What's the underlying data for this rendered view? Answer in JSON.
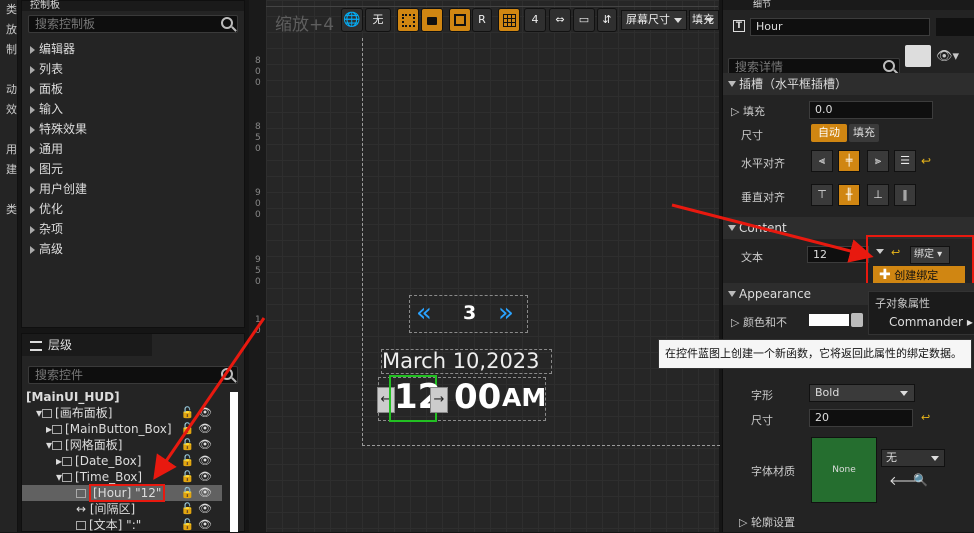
{
  "left_strip": {
    "items": [
      "类",
      "放",
      "制",
      "",
      "动",
      "效",
      "",
      "用",
      "建",
      "",
      "类"
    ]
  },
  "palette": {
    "tab": "控制板",
    "search_placeholder": "搜索控制板",
    "categories": [
      "编辑器",
      "列表",
      "面板",
      "输入",
      "特殊效果",
      "通用",
      "图元",
      "用户创建",
      "优化",
      "杂项",
      "高级"
    ]
  },
  "hierarchy": {
    "tab": "层级",
    "search_placeholder": "搜索控件",
    "rows": [
      {
        "label": "[MainUI_HUD]",
        "bold": true
      },
      {
        "label": "[画布面板]"
      },
      {
        "label": "[MainButton_Box]"
      },
      {
        "label": "[网格面板]"
      },
      {
        "label": "[Date_Box]"
      },
      {
        "label": "[Time_Box]"
      },
      {
        "label": "[Hour] \"12\""
      },
      {
        "label": "[间隔区]"
      },
      {
        "label": "[文本] \":\""
      }
    ]
  },
  "canvas": {
    "zoom_label": "缩放+4",
    "toolbar": {
      "none_label": "无",
      "r_label": "R",
      "snap_value": "4",
      "screen_size": "屏幕尺寸",
      "fill_label": "填充"
    },
    "ruler_numbers": [
      "8",
      "0",
      "0",
      "8",
      "5",
      "0",
      "9",
      "0",
      "0",
      "9",
      "5",
      "0",
      "1",
      "0"
    ],
    "widget": {
      "left_arrow": "«",
      "day_number": "3",
      "right_arrow": "»",
      "date_text": "March 10,2023",
      "hour": "12",
      "minutes": "00",
      "ampm": "AM",
      "left_btn": "←",
      "right_btn": "→"
    }
  },
  "details": {
    "tab": "细节",
    "name_value": "Hour",
    "search_placeholder": "搜索详情",
    "slot_section": "插槽（水平框插槽）",
    "fill_label": "填充",
    "fill_value": "0.0",
    "size_label": "尺寸",
    "size_auto": "自动",
    "size_fill": "填充",
    "h_align_label": "水平对齐",
    "v_align_label": "垂直对齐",
    "content_section": "Content",
    "text_label": "文本",
    "text_value": "12",
    "bind_button": "绑定",
    "create_binding": "创建绑定",
    "child_prop": "子对象属性",
    "commander": "Commander",
    "appearance_section": "Appearance",
    "color_label": "颜色和不",
    "typeface_label": "字形",
    "typeface_value": "Bold",
    "font_size_label": "尺寸",
    "font_size_value": "20",
    "font_material_label": "字体材质",
    "material_none": "None",
    "material_dropdown": "无",
    "outline_label": "轮廓设置"
  },
  "tooltip": "在控件蓝图上创建一个新函数，它将返回此属性的绑定数据。",
  "colors": {
    "accent": "#d08612",
    "red": "#e8190f",
    "selection_green": "#22c022",
    "arrow_blue": "#2aa3ff"
  }
}
